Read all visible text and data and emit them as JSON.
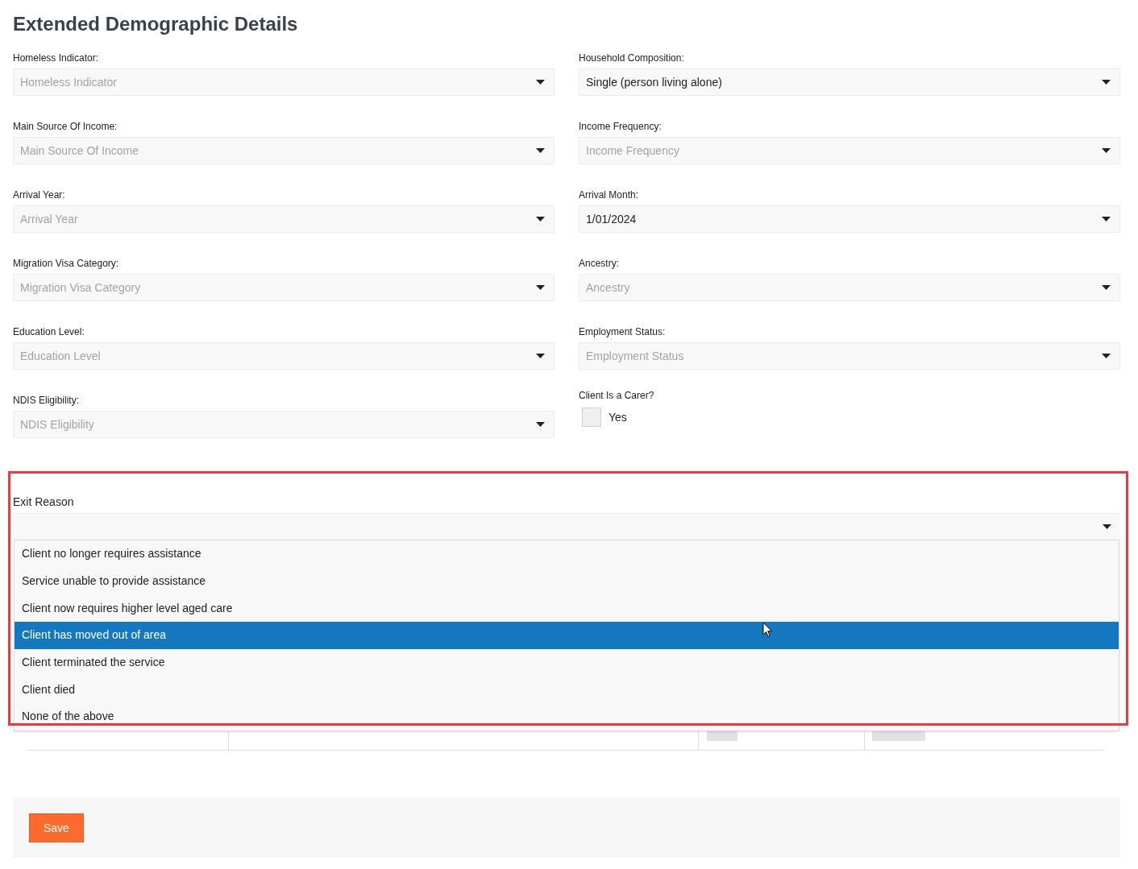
{
  "title": "Extended Demographic Details",
  "fields": [
    {
      "kind": "select",
      "label": "Homeless Indicator:",
      "placeholder": "Homeless Indicator"
    },
    {
      "kind": "select",
      "label": "Household Composition:",
      "value": "Single (person living alone)"
    },
    {
      "kind": "select",
      "label": "Main Source Of Income:",
      "placeholder": "Main Source Of Income"
    },
    {
      "kind": "select",
      "label": "Income Frequency:",
      "placeholder": "Income Frequency"
    },
    {
      "kind": "select",
      "label": "Arrival Year:",
      "placeholder": "Arrival Year"
    },
    {
      "kind": "select",
      "label": "Arrival Month:",
      "value": "1/01/2024"
    },
    {
      "kind": "select",
      "label": "Migration Visa Category:",
      "placeholder": "Migration Visa Category"
    },
    {
      "kind": "select",
      "label": "Ancestry:",
      "placeholder": "Ancestry"
    },
    {
      "kind": "select",
      "label": "Education Level:",
      "placeholder": "Education Level"
    },
    {
      "kind": "select",
      "label": "Employment Status:",
      "placeholder": "Employment Status"
    },
    {
      "kind": "select",
      "label": "NDIS Eligibility:",
      "placeholder": "NDIS Eligibility"
    },
    {
      "kind": "checkbox",
      "label": "Client Is a Carer?",
      "option": "Yes",
      "checked": false
    }
  ],
  "exit_reason": {
    "label": "Exit Reason",
    "expanded": true,
    "options": [
      {
        "label": "Client no longer requires assistance",
        "selected": false
      },
      {
        "label": "Service unable to provide assistance",
        "selected": false
      },
      {
        "label": "Client now requires higher level aged care",
        "selected": false
      },
      {
        "label": "Client has moved out of area",
        "selected": true
      },
      {
        "label": "Client terminated the service",
        "selected": false
      },
      {
        "label": "Client died",
        "selected": false
      },
      {
        "label": "None of the above",
        "selected": false
      }
    ]
  },
  "save_button": "Save"
}
